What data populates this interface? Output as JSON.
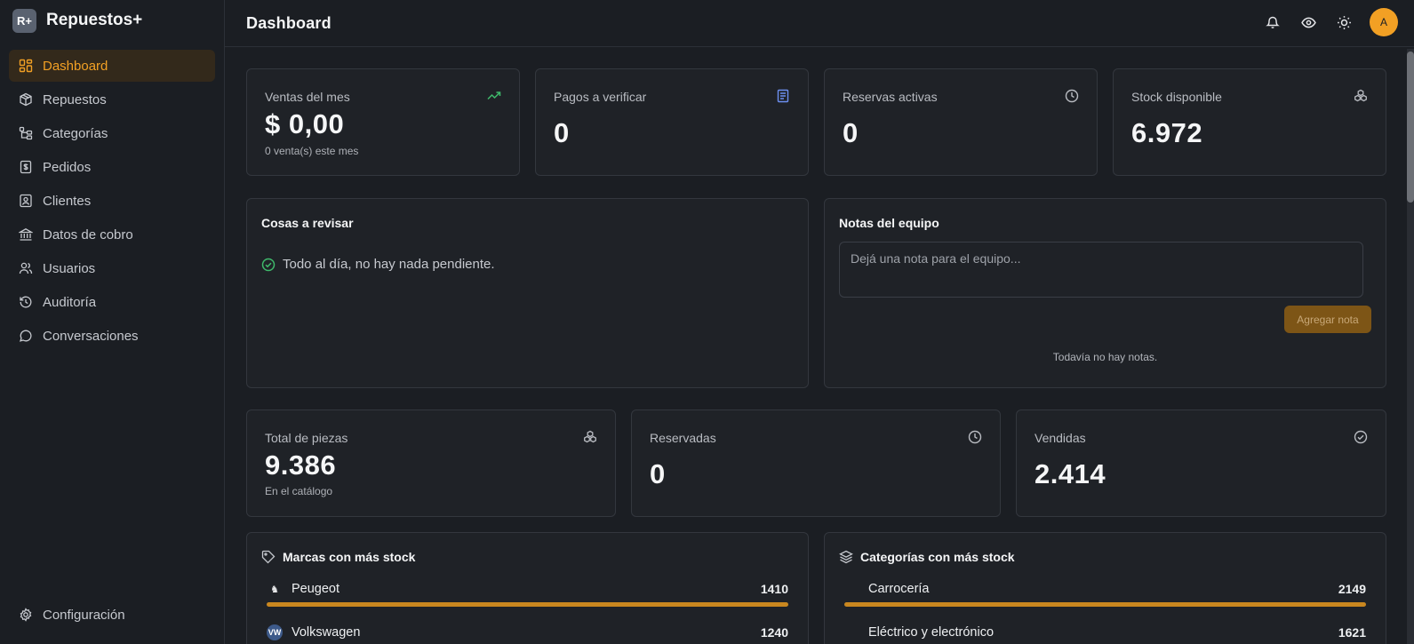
{
  "brand": {
    "logo": "R+",
    "name": "Repuestos+"
  },
  "sidebar": {
    "items": [
      {
        "label": "Dashboard",
        "icon": "dashboard-grid-icon",
        "active": true
      },
      {
        "label": "Repuestos",
        "icon": "box-icon"
      },
      {
        "label": "Categorías",
        "icon": "category-tree-icon"
      },
      {
        "label": "Pedidos",
        "icon": "receipt-icon"
      },
      {
        "label": "Clientes",
        "icon": "contact-card-icon"
      },
      {
        "label": "Datos de cobro",
        "icon": "bank-icon"
      },
      {
        "label": "Usuarios",
        "icon": "users-icon"
      },
      {
        "label": "Auditoría",
        "icon": "history-icon"
      },
      {
        "label": "Conversaciones",
        "icon": "chat-bubble-icon"
      }
    ],
    "settings_label": "Configuración"
  },
  "header": {
    "title": "Dashboard",
    "avatar_initial": "A"
  },
  "stats_top": [
    {
      "label": "Ventas del mes",
      "value": "$ 0,00",
      "sub": "0 venta(s) este mes",
      "icon": "trending-up-icon",
      "icon_color": "#3fb96b"
    },
    {
      "label": "Pagos a verificar",
      "value": "0",
      "icon": "document-icon",
      "icon_color": "#6d8ff0"
    },
    {
      "label": "Reservas activas",
      "value": "0",
      "icon": "clock-icon",
      "icon_color": "#b9bcc2"
    },
    {
      "label": "Stock disponible",
      "value": "6.972",
      "icon": "boxes-icon",
      "icon_color": "#b9bcc2"
    }
  ],
  "review": {
    "title": "Cosas a revisar",
    "message": "Todo al día, no hay nada pendiente."
  },
  "notes": {
    "title": "Notas del equipo",
    "placeholder": "Dejá una nota para el equipo...",
    "button": "Agregar nota",
    "empty": "Todavía no hay notas."
  },
  "stats_mid": [
    {
      "label": "Total de piezas",
      "value": "9.386",
      "sub": "En el catálogo",
      "icon": "boxes-icon"
    },
    {
      "label": "Reservadas",
      "value": "0",
      "icon": "clock-icon"
    },
    {
      "label": "Vendidas",
      "value": "2.414",
      "icon": "check-circle-icon"
    }
  ],
  "brands_stock": {
    "title": "Marcas con más stock",
    "rows": [
      {
        "name": "Peugeot",
        "value": "1410",
        "fraction": 1.0
      },
      {
        "name": "Volkswagen",
        "value": "1240",
        "fraction": 0.879
      }
    ]
  },
  "categories_stock": {
    "title": "Categorías con más stock",
    "rows": [
      {
        "name": "Carrocería",
        "value": "2149",
        "fraction": 1.0
      },
      {
        "name": "Eléctrico y electrónico",
        "value": "1621",
        "fraction": 0.754
      }
    ]
  },
  "colors": {
    "accent": "#f2a024",
    "bar": "#c9871f",
    "background": "#1b1e23",
    "card": "#1f2227"
  }
}
